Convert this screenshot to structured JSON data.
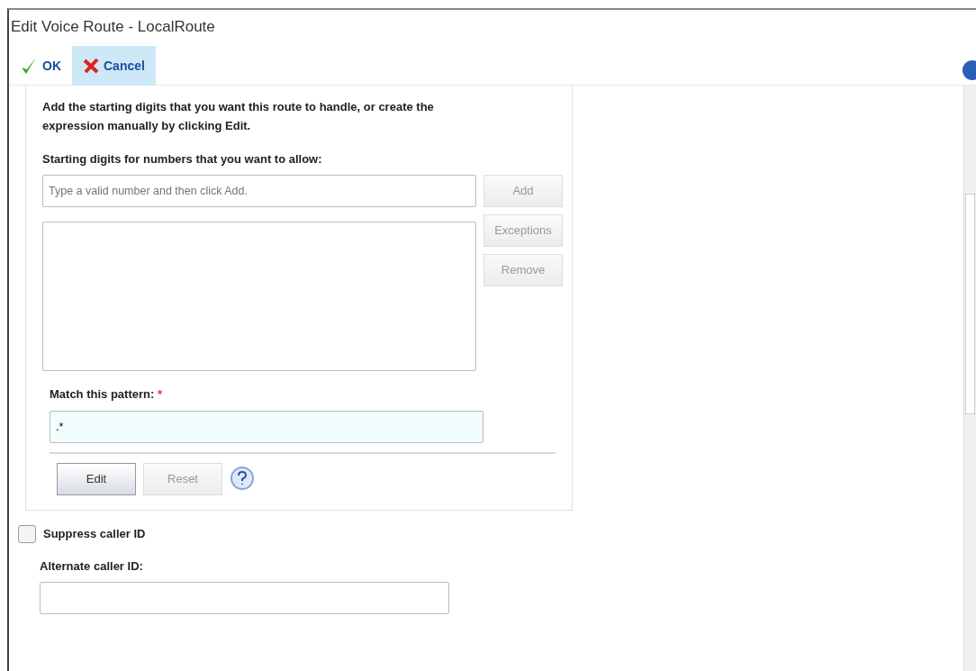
{
  "window": {
    "title": "Edit Voice Route - LocalRoute"
  },
  "toolbar": [
    {
      "kind": "ok",
      "label": "OK",
      "selected": false
    },
    {
      "kind": "cancel",
      "label": "Cancel",
      "selected": true
    }
  ],
  "pattern_panel": {
    "instructions": "Add the starting digits that you want this route to handle, or create the expression manually by clicking Edit.",
    "digits_label": "Starting digits for numbers that you want to allow:",
    "digits_field": {
      "placeholder": "Type a valid number and then click Add."
    },
    "side_buttons": [
      {
        "label": "Add",
        "disabled": true
      },
      {
        "label": "Exceptions",
        "disabled": true
      },
      {
        "label": "Remove",
        "disabled": true
      }
    ],
    "pattern_label": "Match this pattern:",
    "required_mark": "*",
    "pattern_field": {
      "value": ".*"
    },
    "buttons": [
      {
        "label": "Edit",
        "disabled": false
      },
      {
        "label": "Reset",
        "disabled": true
      }
    ]
  },
  "suppress_caller_id": {
    "label": "Suppress caller ID",
    "checked": false
  },
  "alternate_caller_id": {
    "label": "Alternate caller ID:"
  }
}
